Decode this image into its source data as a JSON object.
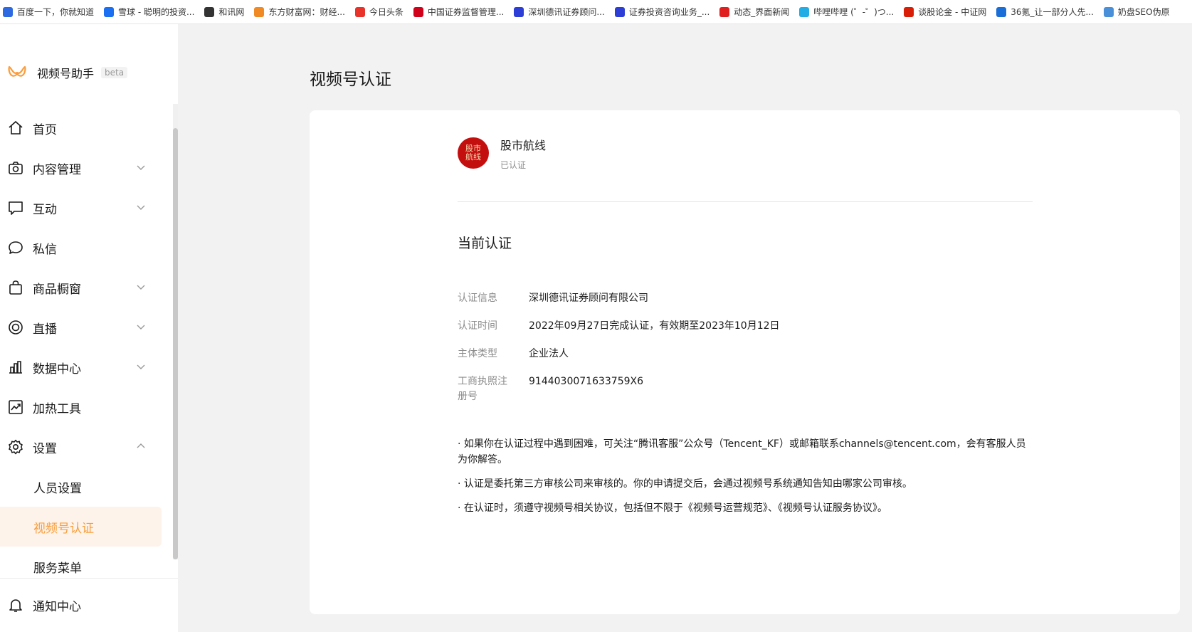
{
  "bookmarks": [
    {
      "label": "百度一下，你就知道",
      "icon": "baidu-icon",
      "color": "#2d69e0"
    },
    {
      "label": "雪球 - 聪明的投资...",
      "icon": "xueqiu-icon",
      "color": "#1b6ff1"
    },
    {
      "label": "和讯网",
      "icon": "hexun-icon",
      "color": "#333333"
    },
    {
      "label": "东方财富网：财经...",
      "icon": "eastmoney-icon",
      "color": "#f08a24"
    },
    {
      "label": "今日头条",
      "icon": "toutiao-icon",
      "color": "#e8332b"
    },
    {
      "label": "中国证券监督管理...",
      "icon": "csrc-icon",
      "color": "#d0021b"
    },
    {
      "label": "深圳德讯证券顾问...",
      "icon": "baidu-paw-icon",
      "color": "#2d3ed6"
    },
    {
      "label": "证券投资咨询业务_...",
      "icon": "baidu-paw-icon",
      "color": "#2d3ed6"
    },
    {
      "label": "动态_界面新闻",
      "icon": "jiemian-icon",
      "color": "#e02020"
    },
    {
      "label": "哔哩哔哩 (゜-゜)つ...",
      "icon": "bilibili-icon",
      "color": "#23ade5"
    },
    {
      "label": "谈股论金 - 中证网",
      "icon": "cs-icon",
      "color": "#d81e06"
    },
    {
      "label": "36氪_让一部分人先...",
      "icon": "36kr-icon",
      "color": "#1a6ed8"
    },
    {
      "label": "奶盘SEO伪原",
      "icon": "naipan-icon",
      "color": "#4a90d9"
    }
  ],
  "sidebar": {
    "app_name": "视频号助手",
    "beta": "beta",
    "accent": "#fa9d3b",
    "items": [
      {
        "label": "首页",
        "icon": "home-icon"
      },
      {
        "label": "内容管理",
        "icon": "camera-icon",
        "chevron": "down"
      },
      {
        "label": "互动",
        "icon": "comment-icon",
        "chevron": "down"
      },
      {
        "label": "私信",
        "icon": "message-icon"
      },
      {
        "label": "商品橱窗",
        "icon": "shopping-bag-icon",
        "chevron": "down"
      },
      {
        "label": "直播",
        "icon": "live-icon",
        "chevron": "down"
      },
      {
        "label": "数据中心",
        "icon": "bar-chart-icon",
        "chevron": "down"
      },
      {
        "label": "加热工具",
        "icon": "trend-icon"
      },
      {
        "label": "设置",
        "icon": "gear-icon",
        "chevron": "up"
      }
    ],
    "sub_items": [
      {
        "label": "人员设置",
        "active": false
      },
      {
        "label": "视频号认证",
        "active": true
      },
      {
        "label": "服务菜单",
        "active": false
      }
    ],
    "notify": {
      "label": "通知中心",
      "icon": "bell-icon"
    }
  },
  "main": {
    "title": "视频号认证",
    "account": {
      "name": "股市航线",
      "status": "已认证",
      "avatar_text": "股市航线"
    },
    "section_title": "当前认证",
    "info": [
      {
        "label": "认证信息",
        "value": "深圳德讯证券顾问有限公司"
      },
      {
        "label": "认证时间",
        "value": "2022年09月27日完成认证，有效期至2023年10月12日"
      },
      {
        "label": "主体类型",
        "value": "企业法人"
      },
      {
        "label": "工商执照注册号",
        "value": "9144030071633759X6"
      }
    ],
    "notes": [
      "· 如果你在认证过程中遇到困难，可关注“腾讯客服”公众号（Tencent_KF）或邮箱联系channels@tencent.com，会有客服人员为你解答。",
      "· 认证是委托第三方审核公司来审核的。你的申请提交后，会通过视频号系统通知告知由哪家公司审核。",
      "· 在认证时，须遵守视频号相关协议，包括但不限于《视频号运营规范》、《视频号认证服务协议》。"
    ]
  }
}
